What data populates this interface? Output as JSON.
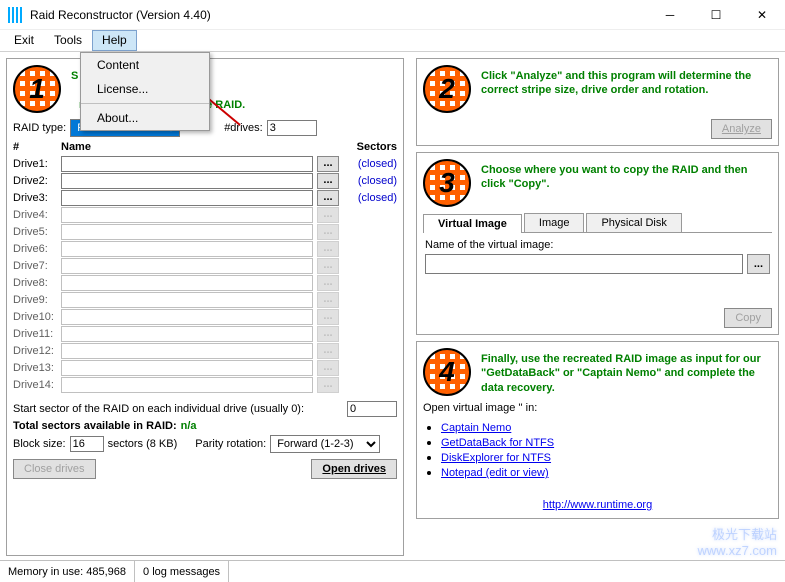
{
  "window": {
    "title": "Raid Reconstructor (Version 4.40)"
  },
  "menubar": {
    "exit": "Exit",
    "tools": "Tools",
    "help": "Help"
  },
  "helpmenu": {
    "content": "Content",
    "license": "License...",
    "about": "About..."
  },
  "step1": {
    "num": "1",
    "text_a": "ves in this RAID array.",
    "text_b": "mages that constitute the RAID."
  },
  "raid": {
    "type_label": "RAID type:",
    "type_value": "RAID-5",
    "drives_label": "#drives:",
    "drives_value": "3"
  },
  "drives_header": {
    "num": "#",
    "name": "Name",
    "sectors": "Sectors"
  },
  "drives": [
    {
      "label": "Drive1:",
      "sector": "(closed)",
      "active": true
    },
    {
      "label": "Drive2:",
      "sector": "(closed)",
      "active": true
    },
    {
      "label": "Drive3:",
      "sector": "(closed)",
      "active": true
    },
    {
      "label": "Drive4:",
      "sector": "",
      "active": false
    },
    {
      "label": "Drive5:",
      "sector": "",
      "active": false
    },
    {
      "label": "Drive6:",
      "sector": "",
      "active": false
    },
    {
      "label": "Drive7:",
      "sector": "",
      "active": false
    },
    {
      "label": "Drive8:",
      "sector": "",
      "active": false
    },
    {
      "label": "Drive9:",
      "sector": "",
      "active": false
    },
    {
      "label": "Drive10:",
      "sector": "",
      "active": false
    },
    {
      "label": "Drive11:",
      "sector": "",
      "active": false
    },
    {
      "label": "Drive12:",
      "sector": "",
      "active": false
    },
    {
      "label": "Drive13:",
      "sector": "",
      "active": false
    },
    {
      "label": "Drive14:",
      "sector": "",
      "active": false
    }
  ],
  "start_sector": {
    "label": "Start sector of the RAID on each individual drive (usually 0):",
    "value": "0"
  },
  "total_sectors": {
    "label": "Total sectors available in RAID:",
    "value": "n/a"
  },
  "block": {
    "size_label": "Block size:",
    "size_value": "16",
    "size_hint": "sectors (8 KB)",
    "rotation_label": "Parity rotation:",
    "rotation_value": "Forward (1-2-3)"
  },
  "buttons": {
    "close_drives": "Close drives",
    "open_drives": "Open drives",
    "analyze": "Analyze",
    "copy": "Copy",
    "browse": "..."
  },
  "step2": {
    "num": "2",
    "text": "Click \"Analyze\" and this program will determine the correct stripe size, drive order and rotation."
  },
  "step3": {
    "num": "3",
    "text": "Choose where you want to copy the RAID and then click \"Copy\"."
  },
  "tabs": {
    "virtual": "Virtual Image",
    "image": "Image",
    "physical": "Physical Disk"
  },
  "virtual": {
    "label": "Name of the virtual image:",
    "value": ""
  },
  "step4": {
    "num": "4",
    "text": "Finally, use the recreated RAID image as input for our \"GetDataBack\" or \"Captain Nemo\" and complete the data recovery."
  },
  "openin": {
    "label": "Open virtual image '' in:"
  },
  "links": {
    "l1": "Captain Nemo",
    "l2": "GetDataBack for NTFS",
    "l3": "DiskExplorer for NTFS",
    "l4": "Notepad (edit or view)",
    "runtime": "http://www.runtime.org"
  },
  "status": {
    "mem": "Memory in use: 485,968",
    "log": "0 log messages"
  },
  "watermark": "极光下载站\nwww.xz7.com"
}
